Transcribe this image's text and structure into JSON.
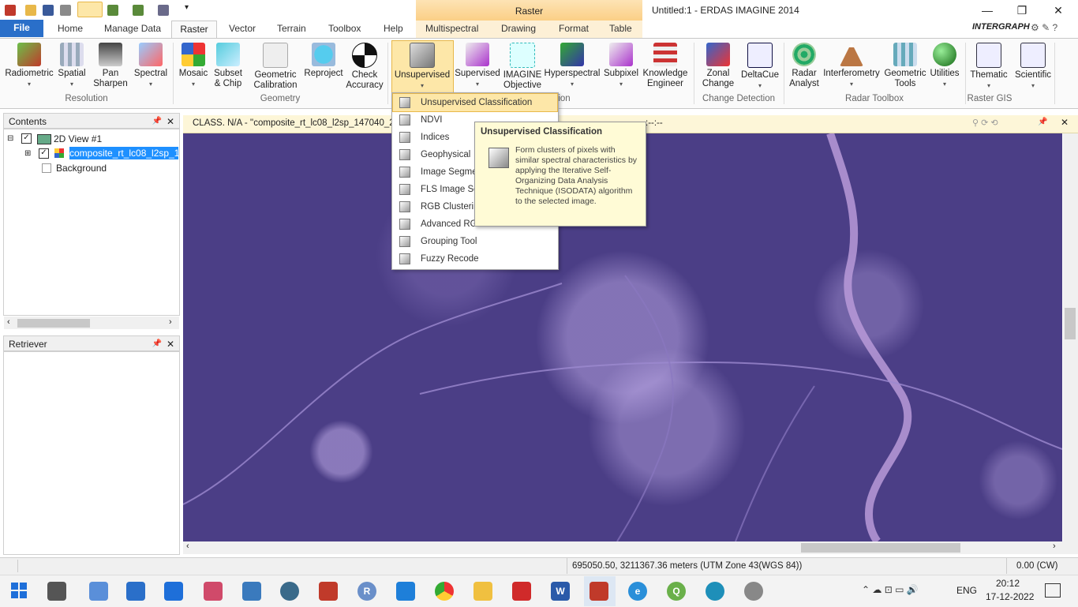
{
  "window": {
    "title": "Untitled:1 - ERDAS IMAGINE 2014",
    "contextual_tab_header": "Raster",
    "brand": "INTERGRAPH",
    "controls": {
      "minimize": "—",
      "restore": "❐",
      "close": "✕"
    }
  },
  "tabs": {
    "file": "File",
    "home": "Home",
    "manage_data": "Manage Data",
    "raster": "Raster",
    "vector": "Vector",
    "terrain": "Terrain",
    "toolbox": "Toolbox",
    "help": "Help",
    "multispectral": "Multispectral",
    "drawing": "Drawing",
    "format": "Format",
    "table": "Table"
  },
  "ribbon": {
    "buttons": {
      "radiometric": "Radiometric",
      "spatial": "Spatial",
      "pan_sharpen_1": "Pan",
      "pan_sharpen_2": "Sharpen",
      "spectral": "Spectral",
      "mosaic": "Mosaic",
      "subset_1": "Subset",
      "subset_2": "& Chip",
      "geometric_1": "Geometric",
      "geometric_2": "Calibration",
      "reproject": "Reproject",
      "check_1": "Check",
      "check_2": "Accuracy",
      "unsupervised": "Unsupervised",
      "supervised": "Supervised",
      "imagine_obj_1": "IMAGINE",
      "imagine_obj_2": "Objective",
      "hyperspectral": "Hyperspectral",
      "subpixel": "Subpixel",
      "knowledge_1": "Knowledge",
      "knowledge_2": "Engineer",
      "zonal_1": "Zonal",
      "zonal_2": "Change",
      "deltacue": "DeltaCue",
      "radar_1": "Radar",
      "radar_2": "Analyst",
      "interferometry": "Interferometry",
      "geo_tools_1": "Geometric",
      "geo_tools_2": "Tools",
      "utilities": "Utilities",
      "thematic": "Thematic",
      "scientific": "Scientific"
    },
    "groups": {
      "resolution": "Resolution",
      "geometry": "Geometry",
      "classification_partial": "ion",
      "change_detection": "Change Detection",
      "radar_toolbox": "Radar Toolbox",
      "raster_gis": "Raster GIS"
    }
  },
  "contents_panel": {
    "title": "Contents",
    "view": "2D View #1",
    "layer": "composite_rt_lc08_l2sp_14",
    "background": "Background"
  },
  "retriever_panel": {
    "title": "Retriever"
  },
  "view_header": {
    "title": "CLASS. N/A - ''composite_rt_lc08_l2sp_147040_202",
    "trailing": ":--:--"
  },
  "dropdown": {
    "items": [
      "Unsupervised Classification",
      "NDVI",
      "Indices",
      "Geophysical",
      "Image Segme",
      "FLS Image Se",
      "RGB Clusterin",
      "Advanced RG",
      "Grouping Tool",
      "Fuzzy Recode"
    ]
  },
  "tooltip": {
    "title": "Unsupervised Classification",
    "body": "Form clusters of pixels with similar spectral characteristics by applying the Iterative Self-Organizing Data Analysis Technique (ISODATA) algorithm to the selected image."
  },
  "statusbar": {
    "coords": "695050.50, 3211367.36 meters (UTM Zone 43(WGS 84))",
    "rotation": "0.00 (CW)"
  },
  "taskbar": {
    "lang": "ENG",
    "time": "20:12",
    "date": "17-12-2022"
  },
  "colors": {
    "accent_blue": "#2a6fc9",
    "highlight": "#fde7a8",
    "map_base": "#4b3e86",
    "tooltip_bg": "#fffbd6"
  }
}
